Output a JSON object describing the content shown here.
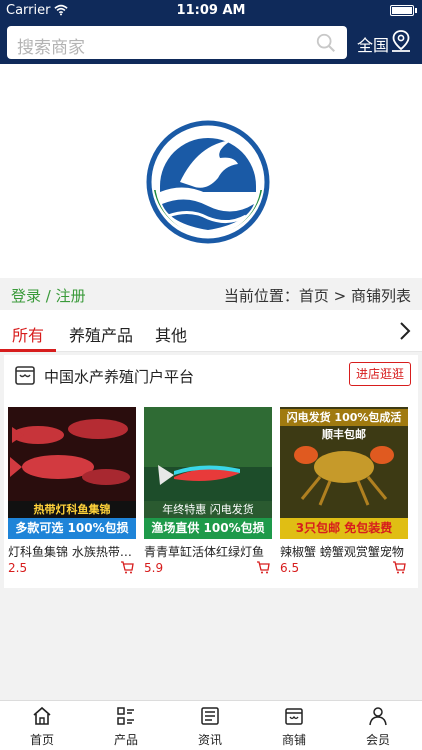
{
  "status_bar": {
    "carrier": "Carrier",
    "time": "11:09 AM"
  },
  "header": {
    "search_placeholder": "搜索商家",
    "region": "全国"
  },
  "breadcrumb": {
    "login_link": "登录 / 注册",
    "location_text": "当前位置：首页 > 商铺列表"
  },
  "tabs": [
    {
      "label": "所有",
      "active": true
    },
    {
      "label": "养殖产品",
      "active": false
    },
    {
      "label": "其他",
      "active": false
    }
  ],
  "shop": {
    "name": "中国水产养殖门户平台",
    "enter_button": "进店逛逛",
    "products": [
      {
        "name": "灯科鱼集锦 水族热带鱼活体",
        "price": "2.5",
        "promo_top": "热带灯科鱼集锦",
        "promo_bottom": "多款可选 100%包损"
      },
      {
        "name": "青青草缸活体红绿灯鱼",
        "price": "5.9",
        "promo_top": "年终特惠 闪电发货",
        "promo_bottom": "渔场直供 100%包损"
      },
      {
        "name": "辣椒蟹 螃蟹观赏蟹宠物",
        "price": "6.5",
        "promo_top": "闪电发货 100%包成活 顺丰包邮",
        "promo_bottom": "3只包邮 免包装费"
      }
    ]
  },
  "bottom_nav": [
    {
      "label": "首页"
    },
    {
      "label": "产品"
    },
    {
      "label": "资讯"
    },
    {
      "label": "商铺"
    },
    {
      "label": "会员"
    }
  ],
  "colors": {
    "header_bg": "#0f2a5a",
    "accent_red": "#d71d1d",
    "login_green": "#3a9a3a",
    "logo_blue": "#1a5aa6"
  }
}
